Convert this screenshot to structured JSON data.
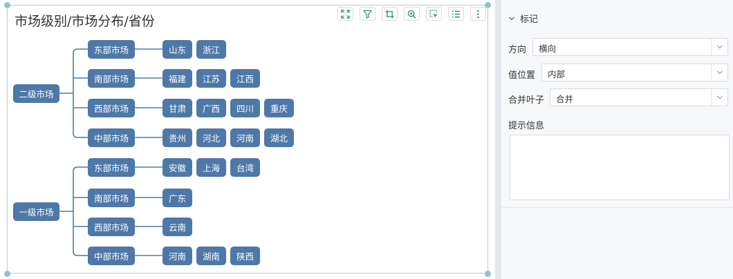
{
  "chart": {
    "title": "市场级别/市场分布/省份"
  },
  "toolbar": {
    "buttons": [
      "fullscreen-icon",
      "filter-icon",
      "crop-icon",
      "zoom-icon",
      "select-icon",
      "list-icon",
      "more-icon"
    ]
  },
  "tree": {
    "groups": [
      {
        "label": "二级市场",
        "children": [
          {
            "label": "东部市场",
            "leaves": [
              "山东",
              "浙江"
            ]
          },
          {
            "label": "南部市场",
            "leaves": [
              "福建",
              "江苏",
              "江西"
            ]
          },
          {
            "label": "西部市场",
            "leaves": [
              "甘肃",
              "广西",
              "四川",
              "重庆"
            ]
          },
          {
            "label": "中部市场",
            "leaves": [
              "贵州",
              "河北",
              "河南",
              "湖北"
            ]
          }
        ]
      },
      {
        "label": "一级市场",
        "children": [
          {
            "label": "东部市场",
            "leaves": [
              "安徽",
              "上海",
              "台湾"
            ]
          },
          {
            "label": "南部市场",
            "leaves": [
              "广东"
            ]
          },
          {
            "label": "西部市场",
            "leaves": [
              "云南"
            ]
          },
          {
            "label": "中部市场",
            "leaves": [
              "河南",
              "湖南",
              "陕西"
            ]
          }
        ]
      }
    ]
  },
  "panel": {
    "section_title": "标记",
    "direction": {
      "label": "方向",
      "value": "横向"
    },
    "value_position": {
      "label": "值位置",
      "value": "内部"
    },
    "merge_leaves": {
      "label": "合并叶子",
      "value": "合并"
    },
    "tooltip": {
      "label": "提示信息"
    }
  },
  "colors": {
    "node": "#4d78a8",
    "link": "#4d78a8",
    "accent": "#2a9d5c"
  }
}
